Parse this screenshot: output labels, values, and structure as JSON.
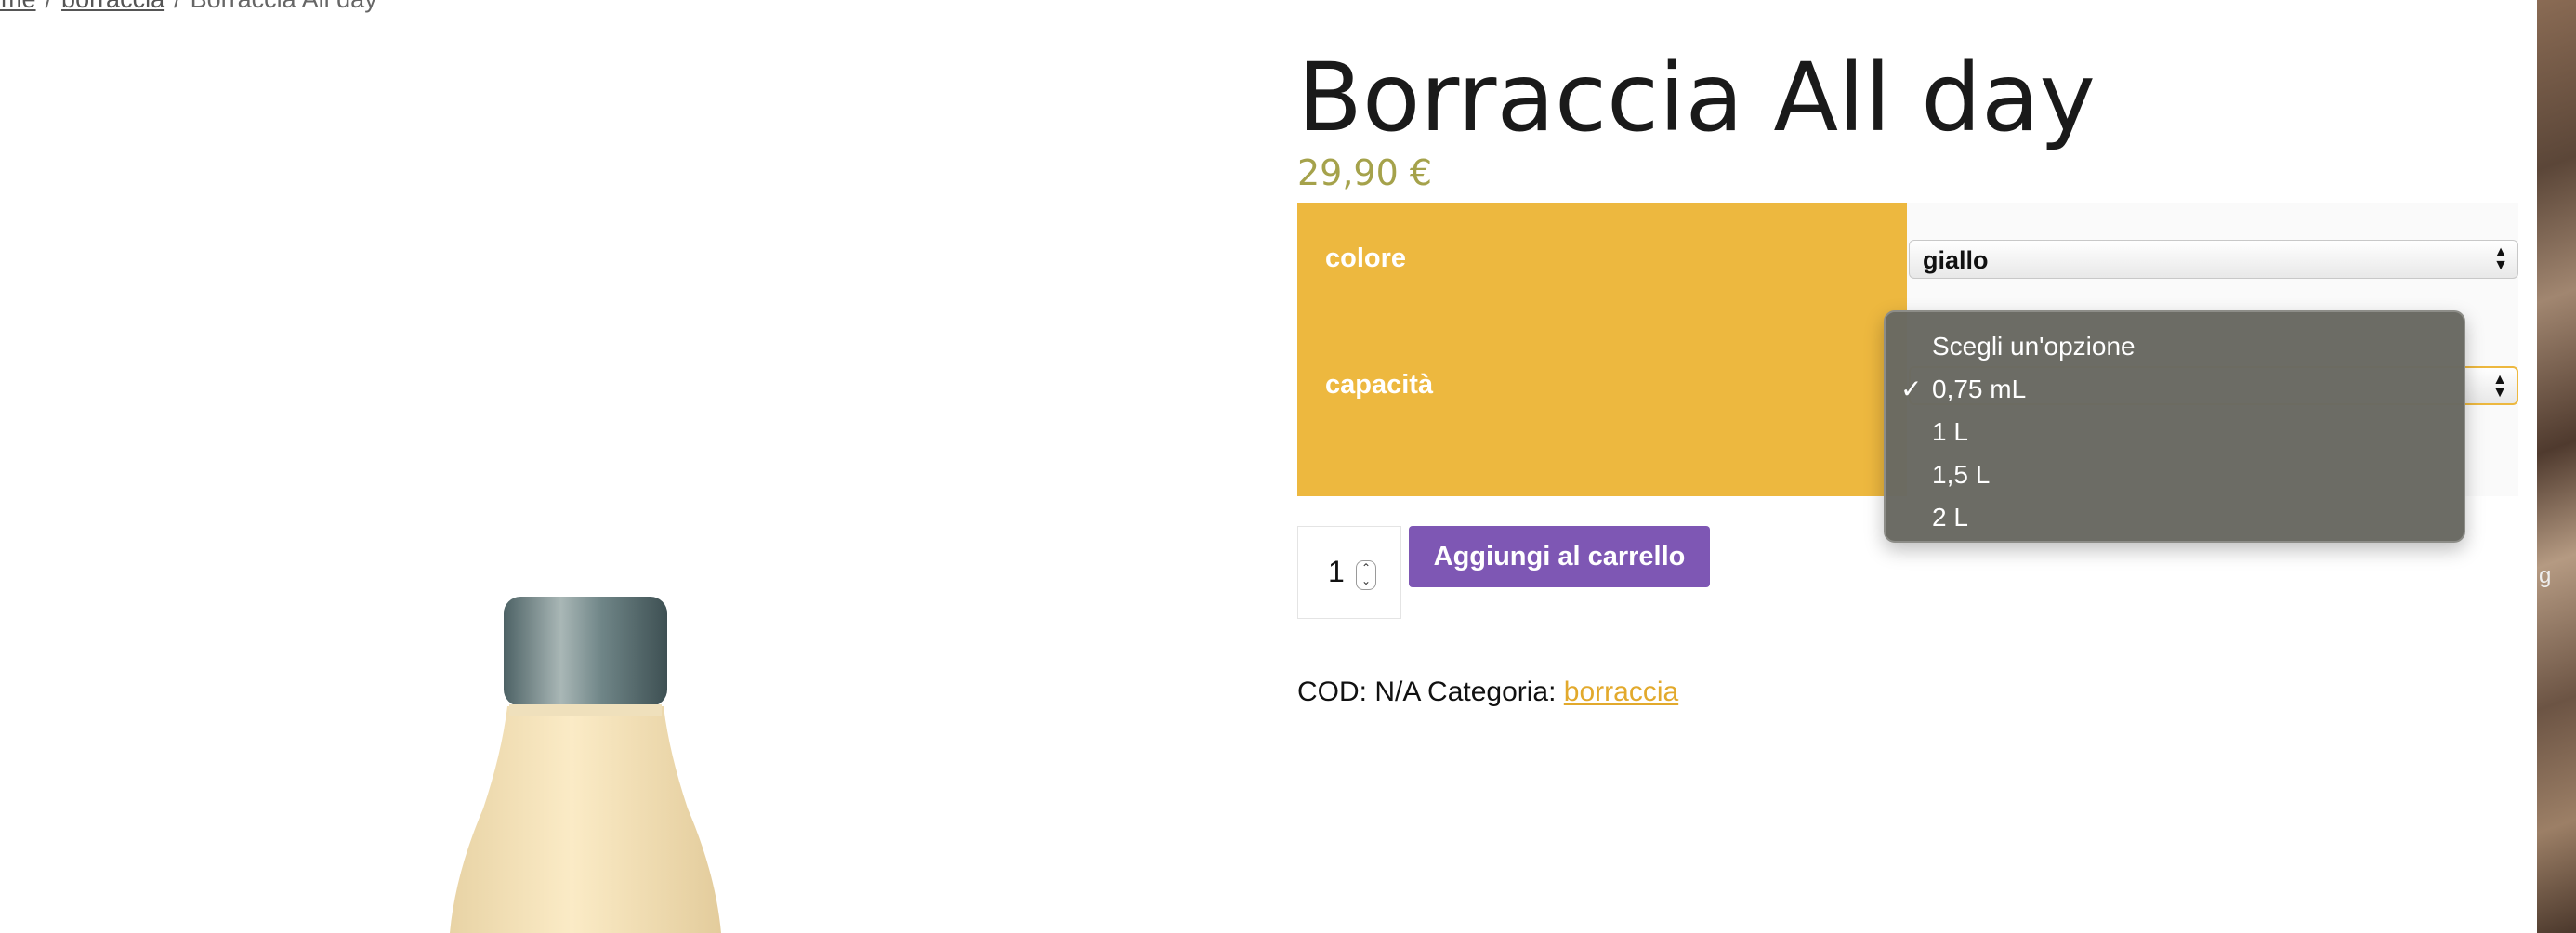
{
  "breadcrumb": {
    "home": "ome",
    "sep1": "/",
    "category": "borraccia",
    "sep2": "/",
    "current": "Borraccia All day"
  },
  "product": {
    "title": "Borraccia All day",
    "price": "29,90 €"
  },
  "variations": {
    "color": {
      "label": "colore",
      "selected": "giallo"
    },
    "capacity": {
      "label": "capacità",
      "options": [
        "Scegli un'opzione",
        "0,75 mL",
        "1 L",
        "1,5 L",
        "2 L"
      ],
      "checked_index": 1,
      "check_mark": "✓"
    }
  },
  "cart": {
    "quantity": "1",
    "add_to_cart_label": "Aggiungi al carrello"
  },
  "meta": {
    "sku_text": "COD: N/A Categoria:",
    "category_link": "borraccia"
  },
  "side": {
    "edge_text": "g"
  },
  "colors": {
    "accent_yellow": "#edb83f",
    "button_purple": "#7e57b4",
    "price_olive": "#a5a24b",
    "link_gold": "#e2a92c"
  }
}
